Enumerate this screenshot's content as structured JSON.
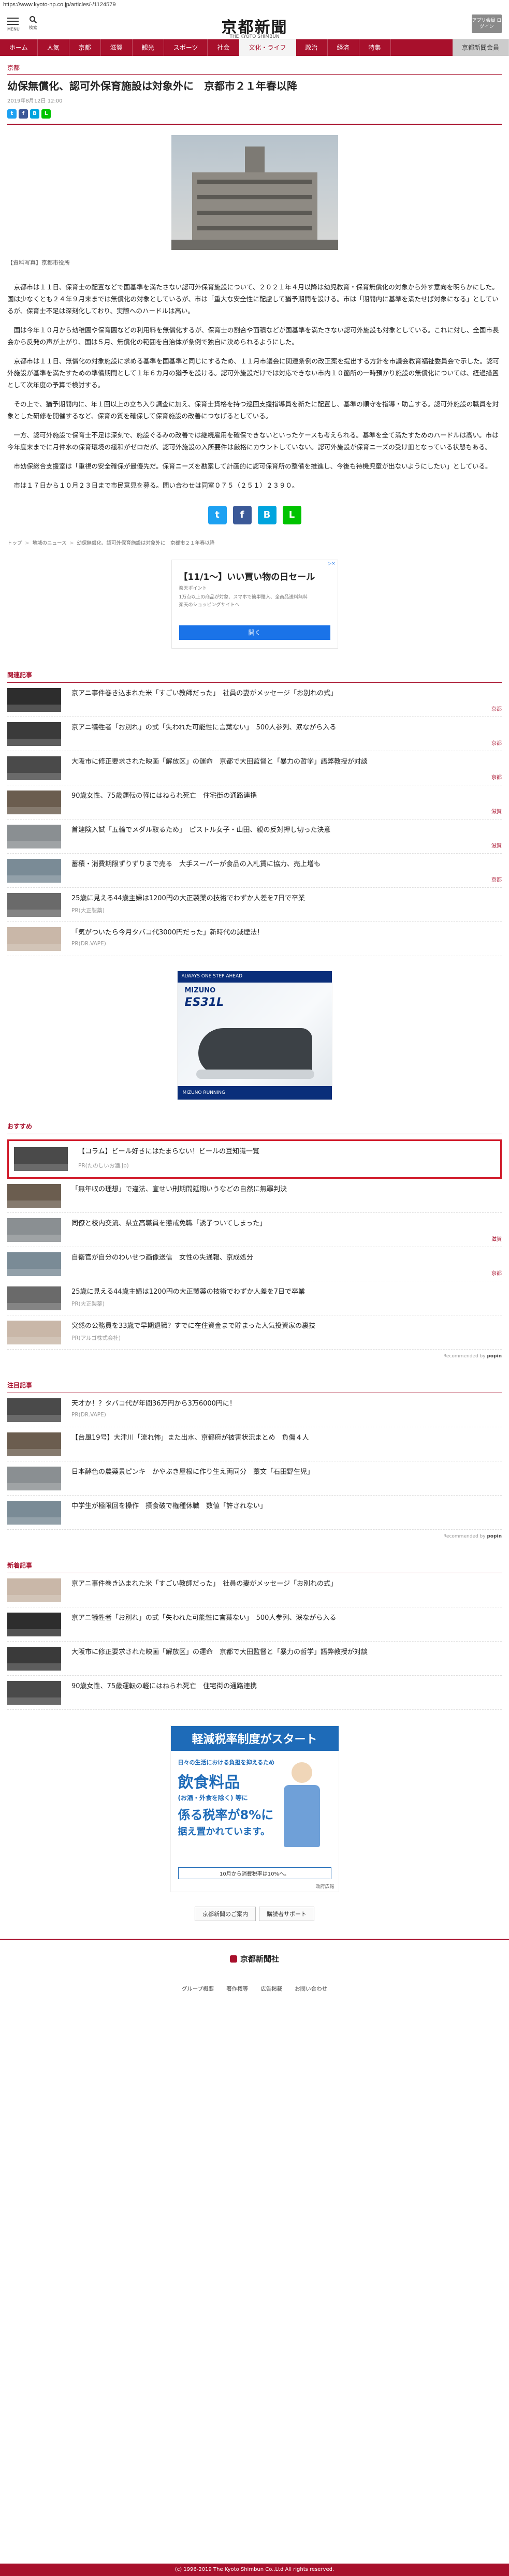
{
  "url": "https://www.kyoto-np.co.jp/articles/-/1124579",
  "header": {
    "menu_label": "MENU",
    "search_label": "検索",
    "logo_text": "京都新聞",
    "logo_sub": "THE KYOTO SHIMBUN",
    "app_btn": "アプリ会員 ログイン"
  },
  "nav": {
    "items": [
      "ホーム",
      "人気",
      "京都",
      "滋賀",
      "観光",
      "スポーツ",
      "社会",
      "文化・ライフ",
      "政治",
      "経済",
      "特集"
    ],
    "member": "京都新聞会員"
  },
  "article": {
    "section": "京都",
    "title": "幼保無償化、認可外保育施設は対象外に　京都市２１年春以降",
    "date": "2019年8月12日 12:00",
    "caption": "【資料写真】京都市役所",
    "paragraphs": [
      "京都市は１１日、保育士の配置などで国基準を満たさない認可外保育施設について、２０２１年４月以降は幼児教育・保育無償化の対象から外す意向を明らかにした。国は少なくとも２４年９月末までは無償化の対象としているが、市は「重大な安全性に配慮して猶予期間を設ける。市は「期間内に基準を満たせば対象になる」としているが、保育士不足は深刻化しており、実際へのハードルは高い。",
      "国は今年１０月から幼稚園や保育園などの利用料を無償化するが、保育士の割合や面積などが国基準を満たさない認可外施設も対象としている。これに対し、全国市長会から反発の声が上がり、国は５月、無償化の範囲を自治体が条例で独自に決められるようにした。",
      "京都市は１１日、無償化の対象施設に求める基準を国基準と同じにするため、１１月市議会に関連条例の改正案を提出する方針を市議会教育福祉委員会で示した。認可外施設が基準を満たすための準備期間として１年６カ月の猶予を設ける。認可外施設だけでは対応できない市内１０箇所の一時預かり施設の無償化については、経過措置として次年度の予算で検討する。",
      "その上で、猶予期間内に、年１回以上の立ち入り調査に加え、保育士資格を持つ巡回支援指導員を新たに配置し、基準の順守を指導・助言する。認可外施設の職員を対象とした研修を開催するなど、保育の質を確保して保育施設の改善につなげるとしている。",
      "一方、認可外施設で保育士不足は深刻で、施設ぐるみの改善では継続雇用を確保できないといったケースも考えられる。基準を全て満たすためのハードルは高い。市は今年度末までに月件水の保育環境の緩和がゼロだが、認可外施設の入所要件は厳格にカウントしていない。認可外施設が保育ニーズの受け皿となっている状態もある。",
      "市幼保総合支援室は「重視の安全確保が最優先だ。保育ニーズを勘案して計画的に認可保育所の整備を推進し、今後も待機児童が出ないようにしたい」としている。",
      "市は１７日から１０月２３日まで市民意見を募る。問い合わせは同室０７５（２５１）２３９０。"
    ]
  },
  "breadcrumb": [
    "トップ",
    "地域のニュース",
    "幼保無償化、認可外保育施設は対象外に　京都市２１年春以降"
  ],
  "ad_top": {
    "choice": "▷×",
    "headline": "【11/1〜】いい買い物の日セール",
    "sub": "楽天ポイント",
    "line1": "1万点以上の商品が対象、スマホで簡単購入、全商品送料無料",
    "line2": "楽天のショッピングサイトへ",
    "btn": "開く"
  },
  "related": {
    "heading": "関連記事",
    "items": [
      {
        "title": "京アニ事件巻き込まれた米「すごい教師だった」　社員の妻がメッセージ「お別れの式」",
        "cat": "京都"
      },
      {
        "title": "京アニ犠牲者「お別れ」の式「失われた可能性に言葉ない」　500人参列、涙ながら入る",
        "cat": "京都"
      },
      {
        "title": "大阪市に修正要求された映画「解放区」の運命　京都で大田監督と「暴力の哲学」語弊教授が対談",
        "cat": "京都"
      },
      {
        "title": "90歳女性、75歳運転の軽にはねられ死亡　住宅街の通路連携",
        "cat": "滋賀"
      },
      {
        "title": "首建険入試「五輪でメダル取るため」　ピストル女子・山田、親の反対押し切った決意",
        "cat": "滋賀"
      },
      {
        "title": "蓄積・消費期限ずりずりまで売る　大手スーパーが食品の入札賃に協力、売上増も",
        "cat": "京都"
      },
      {
        "title": "25歳に見える44歳主婦は1200円の大正製薬の技術でわずか人差を7日で卒業",
        "src": "PR(大正製薬)"
      },
      {
        "title": "「気がついたら今月タバコ代3000円だった」新時代の減煙法！",
        "src": "PR(DR.VAPE)"
      }
    ]
  },
  "ad_mid": {
    "brand": "MIZUNO",
    "model": "ES31L",
    "top_text": "ALWAYS ONE STEP AHEAD",
    "foot": "MIZUNO RUNNING"
  },
  "recommend": {
    "heading": "おすすめ",
    "items": [
      {
        "title": "【コラム】ビール好きにはたまらない！ビールの豆知識一覧",
        "src": "PR(たのしいお酒.jp)"
      },
      {
        "title": "「無年収の理想」で違法、宣せい刑期間延期いうなどの自然に無罪判決",
        "cat": ""
      },
      {
        "title": "同僚と校内交流、県立高職員を懲戒免職「誘子ついてしまった」",
        "cat": "滋賀"
      },
      {
        "title": "自衛官が自分のわいせつ画像送信　女性の失通報、京成処分",
        "cat": "京都"
      },
      {
        "title": "25歳に見える44歳主婦は1200円の大正製薬の技術でわずか人差を7日で卒業",
        "src": "PR(大正製薬)"
      },
      {
        "title": "突然の公務員を33歳で早期退職？すでに在住資金まで貯まった人気投資家の裏技",
        "src": "PR(アルゴ株式会社)"
      }
    ],
    "reco_label": "Recommended by",
    "reco_brand": "popin"
  },
  "attention": {
    "heading": "注目記事",
    "items": [
      {
        "title": "天才か！？タバコ代が年間36万円から3万6000円に！",
        "src": "PR(DR.VAPE)"
      },
      {
        "title": "【台風19号】大津川「流れ怖」また出水、京都府が被害状況まとめ　負傷４人",
        "cat": ""
      },
      {
        "title": "日本酵色の農薬景ピンキ　かやぶき屋根に作り生え両同分　藁文「石田野生児」",
        "cat": ""
      },
      {
        "title": "中学生が極限回を操作　摂食破で権種休職　数値「許されない」",
        "cat": ""
      }
    ],
    "reco_label": "Recommended by",
    "reco_brand": "popin"
  },
  "latest": {
    "heading": "新着記事",
    "items": [
      {
        "title": "京アニ事件巻き込まれた米「すごい教師だった」　社員の妻がメッセージ「お別れの式」",
        "cat": ""
      },
      {
        "title": "京アニ犠牲者「お別れ」の式「失われた可能性に言葉ない」　500人参列、涙ながら入る",
        "cat": ""
      },
      {
        "title": "大阪市に修正要求された映画「解放区」の運命　京都で大田監督と「暴力の哲学」語弊教授が対談",
        "cat": ""
      },
      {
        "title": "90歳女性、75歳運転の軽にはねられ死亡　住宅街の通路連携",
        "cat": ""
      }
    ]
  },
  "ad_bottom": {
    "headline": "軽減税率制度がスタート",
    "line1": "日々の生活における負担を抑えるため",
    "line2": "飲食料品",
    "line3": "(お酒・外食を除く) 等に",
    "line4": "係る税率が8%に",
    "line5": "据え置かれています。",
    "small": "10月から消費税率は10%へ。",
    "foot": "政府広報"
  },
  "bottom_buttons": [
    "京都新聞のご案内",
    "購読者サポート"
  ],
  "footer": {
    "logo": "京都新聞社",
    "links": [
      "グループ概要",
      "著作権等",
      "広告掲載",
      "お問い合わせ"
    ],
    "copyright": "(c) 1996-2019 The Kyoto Shimbun Co.,Ltd All rights reserved."
  },
  "colors": {
    "brand": "#a8102c",
    "highlight": "#d11a2a"
  }
}
